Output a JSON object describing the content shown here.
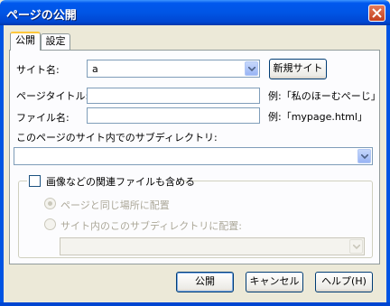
{
  "window": {
    "title": "ページの公開"
  },
  "tabs": [
    {
      "label": "公開"
    },
    {
      "label": "設定"
    }
  ],
  "site": {
    "label": "サイト名:",
    "value": "a",
    "new_button": "新規サイト"
  },
  "page_title": {
    "label": "ページタイトル:",
    "value": "",
    "example": "例:「私のほーむぺーじ」"
  },
  "file_name": {
    "label": "ファイル名:",
    "value": "",
    "example": "例:「mypage.html」"
  },
  "subdir": {
    "label": "このページのサイト内でのサブディレクトリ:",
    "value": ""
  },
  "related": {
    "checkbox_label": "画像などの関連ファイルも含める",
    "checked": false,
    "radio_same": "ページと同じ場所に配置",
    "radio_subdir": "サイト内のこのサブディレクトリに配置:",
    "subdir_value": ""
  },
  "buttons": {
    "publish": "公開",
    "cancel": "キャンセル",
    "help": "ヘルプ(H)"
  },
  "colors": {
    "titlebar": "#0055e5",
    "dialog_bg": "#ece9d8",
    "panel_bg": "#fcfcfe",
    "close": "#c4401f"
  }
}
